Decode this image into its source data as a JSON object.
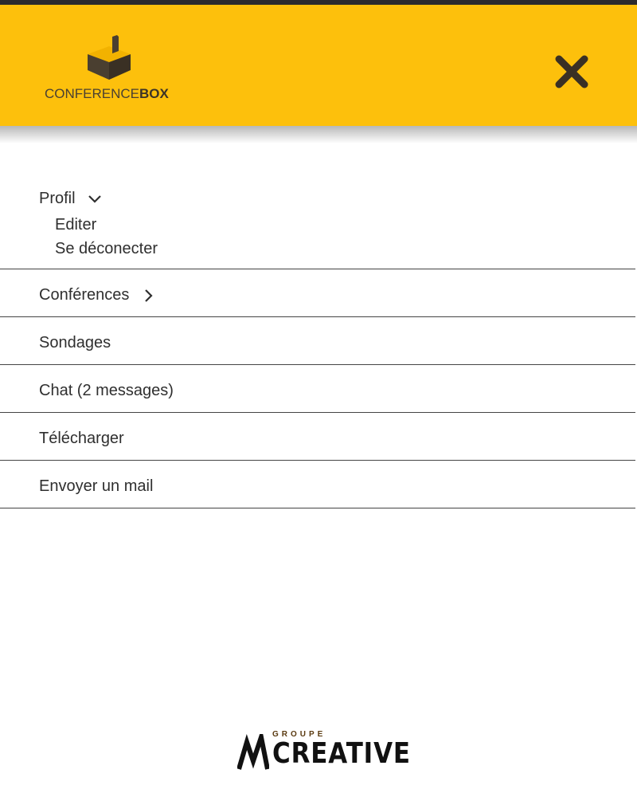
{
  "header": {
    "brand_light": "CONFERENCE",
    "brand_bold": "BOX",
    "logo_icon": "box-logo-icon",
    "close_icon": "close-icon",
    "background_color": "#fdc00c"
  },
  "menu": {
    "profil": {
      "label": "Profil",
      "icon": "chevron-down-icon",
      "sub_items": [
        "Editer",
        "Se déconecter"
      ]
    },
    "items": [
      {
        "label": "Conférences",
        "icon": "chevron-right-icon"
      },
      {
        "label": "Sondages"
      },
      {
        "label": "Chat (2 messages)"
      },
      {
        "label": "Télécharger"
      },
      {
        "label": "Envoyer un mail"
      }
    ]
  },
  "footer": {
    "groupe": "GROUPE",
    "creative": "CREATIVE",
    "mark_icon": "creative-logo-icon"
  }
}
